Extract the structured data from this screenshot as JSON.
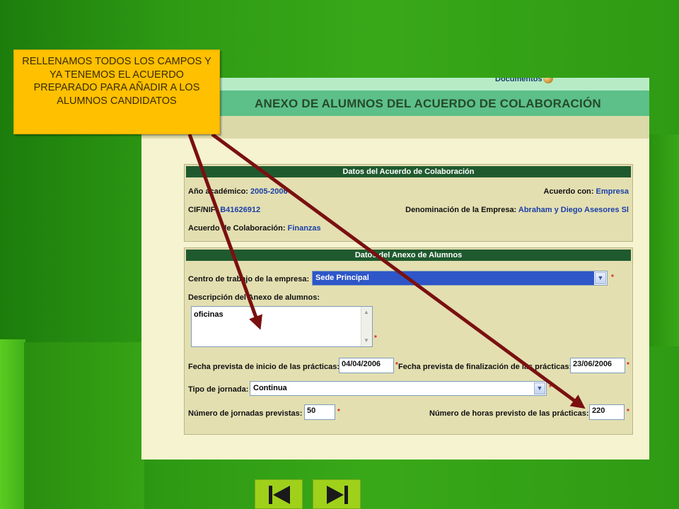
{
  "callout": {
    "text": "RELLENAMOS TODOS LOS CAMPOS Y YA TENEMOS EL ACUERDO PREPARADO PARA AÑADIR A LOS ALUMNOS CANDIDATOS"
  },
  "app": {
    "documentos_label": "Documentos",
    "page_title": "ANEXO DE ALUMNOS DEL ACUERDO DE COLABORACIÓN"
  },
  "acuerdo": {
    "header": "Datos del Acuerdo de Colaboración",
    "anio_label": "Año académico:",
    "anio_value": "2005-2006",
    "acuerdo_con_label": "Acuerdo con:",
    "acuerdo_con_value": "Empresa",
    "cif_label": "CIF/NIF:",
    "cif_value": "B41626912",
    "denominacion_label": "Denominación de la Empresa:",
    "denominacion_value": "Abraham y Diego Asesores Sl",
    "acuerdo_label": "Acuerdo de Colaboración:",
    "acuerdo_value": "Finanzas"
  },
  "anexo": {
    "header": "Datos del Anexo de Alumnos",
    "centro_label": "Centro de trabajo de la empresa:",
    "centro_value": "Sede Principal",
    "descripcion_label": "Descripción del Anexo de alumnos:",
    "descripcion_value": "oficinas",
    "fecha_inicio_label": "Fecha prevista de inicio de las prácticas:",
    "fecha_inicio_value": "04/04/2006",
    "fecha_fin_label": "Fecha prevista de finalización de las prácticas:",
    "fecha_fin_value": "23/06/2006",
    "tipo_jornada_label": "Tipo de jornada:",
    "tipo_jornada_value": "Continua",
    "num_jornadas_label": "Número de jornadas previstas:",
    "num_jornadas_value": "50",
    "num_horas_label": "Número de horas previsto de las prácticas:",
    "num_horas_value": "220",
    "required_mark": "*"
  },
  "icons": {
    "nav_first": "skip-first-icon",
    "nav_last": "skip-last-icon",
    "documentos": "documentos-icon",
    "dropdown": "chevron-down-icon"
  },
  "colors": {
    "slide_bg": "#2e9a14",
    "callout_bg": "#ffc000",
    "arrow": "#7a1010",
    "panel_header": "#1f5a2e",
    "title_bar": "#5cc088",
    "nav_button": "#9fd11b"
  }
}
